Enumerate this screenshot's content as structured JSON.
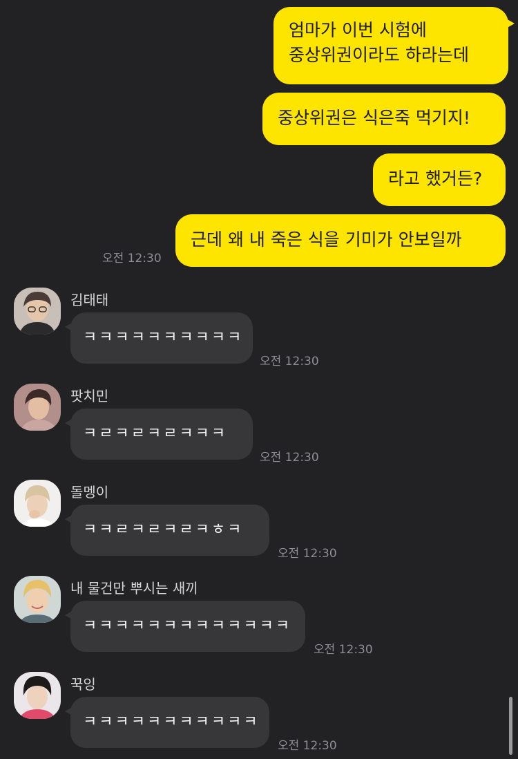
{
  "sent_messages": [
    {
      "line1": "엄마가 이번 시험에",
      "line2": "중상위권이라도 하라는데"
    },
    {
      "text": "중상위권은 식은죽 먹기지!"
    },
    {
      "text": "라고 했거든?"
    },
    {
      "text": "근데 왜 내 죽은 식을 기미가 안보일까"
    }
  ],
  "sent_time": "오전 12:30",
  "received_messages": [
    {
      "sender": "김태태",
      "text": "ㅋㅋㅋㅋㅋㅋㅋㅋㅋㅋ",
      "time": "오전 12:30"
    },
    {
      "sender": "팟치민",
      "text": "ㅋㄹㅋㄹㅋㄹㅋㅋㅋ",
      "time": "오전 12:30"
    },
    {
      "sender": "돌멩이",
      "text": "ㅋㅋㄹㅋㄹㅋㄹㅋㅎㅋ",
      "time": "오전 12:30"
    },
    {
      "sender": "내 물건만 뿌시는 새끼",
      "text": "ㅋㅋㅋㅋㅋㅋㅋㅋㅋㅋㅋㅋㅋ",
      "time": "오전 12:30"
    },
    {
      "sender": "꾹잉",
      "text": "ㅋㅋㅋㅋㅋㅋㅋㅋㅋㅋㅋ",
      "time": "오전 12:30"
    }
  ],
  "colors": {
    "background": "#222124",
    "sent_bubble": "#fee500",
    "received_bubble": "#373638",
    "timestamp": "#8e8e93"
  }
}
